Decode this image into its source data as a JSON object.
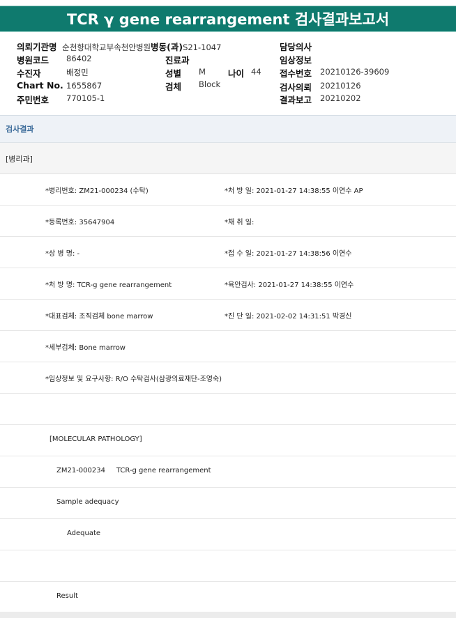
{
  "title": "TCR γ gene rearrangement 검사결과보고서",
  "header": {
    "institution_label": "의뢰기관명",
    "institution_value": "순천향대학교부속천안병원",
    "ward_label": "병동(과)",
    "ward_value": "S21-1047",
    "doctor_label": "담당의사",
    "hospital_code_label": "병원코드",
    "hospital_code_value": "86402",
    "department_label": "진료과",
    "clinical_info_label": "임상정보",
    "patient_label": "수진자",
    "patient_value": "배정민",
    "sex_label": "성별",
    "sex_value": "M",
    "age_label": "나이",
    "age_value": "44",
    "receipt_no_label": "접수번호",
    "receipt_no_value": "20210126-39609",
    "chart_label": "Chart No.",
    "chart_value": "1655867",
    "specimen_label": "검체",
    "specimen_value": "Block",
    "request_label": "검사의뢰",
    "request_value": "20210126",
    "resident_label": "주민번호",
    "resident_value": "770105-1",
    "report_label": "결과보고",
    "report_value": "20210202"
  },
  "results": {
    "section_title": "검사결과",
    "dept": "[병리과]",
    "rows": [
      {
        "left": "*병리번호: ZM21-000234 (수탁)",
        "right": "*처 방 일: 2021-01-27 14:38:55  이연수 AP"
      },
      {
        "left": "*등록번호: 35647904",
        "right": "*채 취 일:"
      },
      {
        "left": "*상 병 명: -",
        "right": "*접 수 일: 2021-01-27 14:38:56  이연수"
      },
      {
        "left": "*처 방 명: TCR-g gene rearrangement",
        "right": "*육안검사: 2021-01-27 14:38:55  이연수"
      },
      {
        "left": "*대표검체: 조직검체 bone marrow",
        "right": "*진 단 일: 2021-02-02 14:31:51  박경신"
      },
      {
        "left": "*세부검체: Bone marrow",
        "right": ""
      },
      {
        "left": "*임상정보 및 요구사항: R/O 수탁검사(삼광의료재단-조영숙)",
        "right": ""
      },
      {
        "left": "",
        "right": ""
      },
      {
        "left": "[MOLECULAR PATHOLOGY]",
        "right": ""
      },
      {
        "left": "ZM21-000234     TCR-g gene rearrangement",
        "right": ""
      },
      {
        "left": "Sample adequacy",
        "right": ""
      },
      {
        "left": "Adequate",
        "right": ""
      },
      {
        "left": "",
        "right": ""
      },
      {
        "left": "Result",
        "right": ""
      }
    ]
  }
}
